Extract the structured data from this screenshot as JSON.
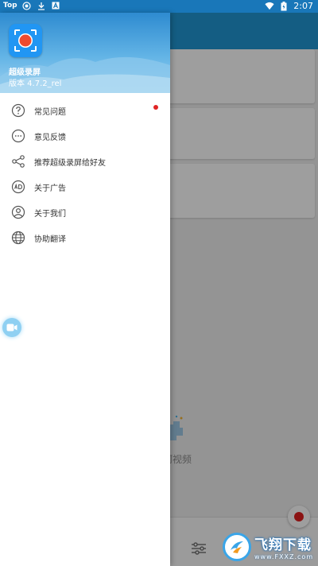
{
  "status_bar": {
    "top_label": "Top",
    "time": "2:07",
    "left_icons": [
      "record-status-icon",
      "download-icon",
      "a-notification-icon"
    ],
    "right_icons": [
      "wifi-icon",
      "battery-icon"
    ]
  },
  "drawer": {
    "app_name": "超级录屏",
    "app_version": "版本 4.7.2_rel",
    "menu_items": [
      {
        "label": "常见问题",
        "icon": "question-icon",
        "badge": true
      },
      {
        "label": "意见反馈",
        "icon": "feedback-dots-icon",
        "badge": false
      },
      {
        "label": "推荐超级录屏给好友",
        "icon": "share-icon",
        "badge": false
      },
      {
        "label": "关于广告",
        "icon": "ad-icon",
        "badge": false
      },
      {
        "label": "关于我们",
        "icon": "person-icon",
        "badge": false
      },
      {
        "label": "协助翻译",
        "icon": "globe-icon",
        "badge": false
      }
    ]
  },
  "background": {
    "empty_text": "河视频"
  },
  "watermark": {
    "title": "飞翔下载",
    "url": "www.FXXZ.com"
  },
  "colors": {
    "status_bar": "#1977b9",
    "app_bar": "#2196d3",
    "badge": "#e02424",
    "record": "#e02020"
  }
}
